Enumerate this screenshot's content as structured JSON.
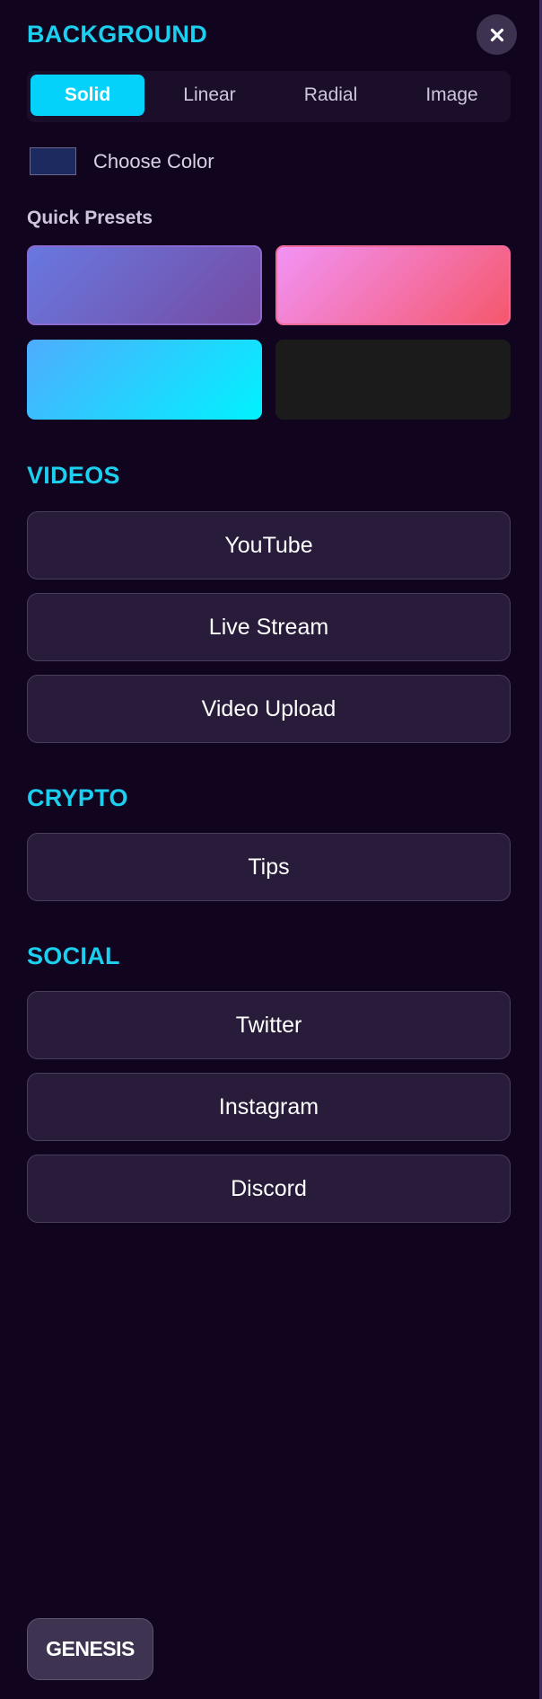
{
  "background": {
    "title": "BACKGROUND",
    "tabs": [
      {
        "label": "Solid",
        "active": true
      },
      {
        "label": "Linear",
        "active": false
      },
      {
        "label": "Radial",
        "active": false
      },
      {
        "label": "Image",
        "active": false
      }
    ],
    "choose_color_label": "Choose Color",
    "current_color": "#1c2a5f",
    "quick_presets_label": "Quick Presets",
    "presets": [
      {
        "name": "purple-gradient",
        "colors": [
          "#6878e0",
          "#764ba2"
        ]
      },
      {
        "name": "pink-gradient",
        "colors": [
          "#f293f6",
          "#f5576c"
        ]
      },
      {
        "name": "cyan-gradient",
        "colors": [
          "#4facfe",
          "#00f2fe"
        ]
      },
      {
        "name": "dark-solid",
        "colors": [
          "#1b1b1b"
        ]
      }
    ]
  },
  "close_icon": "close-icon",
  "videos": {
    "title": "VIDEOS",
    "buttons": [
      "YouTube",
      "Live Stream",
      "Video Upload"
    ]
  },
  "crypto": {
    "title": "CRYPTO",
    "buttons": [
      "Tips"
    ]
  },
  "social": {
    "title": "SOCIAL",
    "buttons": [
      "Twitter",
      "Instagram",
      "Discord"
    ]
  },
  "brand": {
    "label": "GENESIS"
  },
  "colors": {
    "accent": "#1ccfee",
    "active_tab": "#04d2fa",
    "page_background": "#11041f",
    "button_background": "#281c3a"
  }
}
